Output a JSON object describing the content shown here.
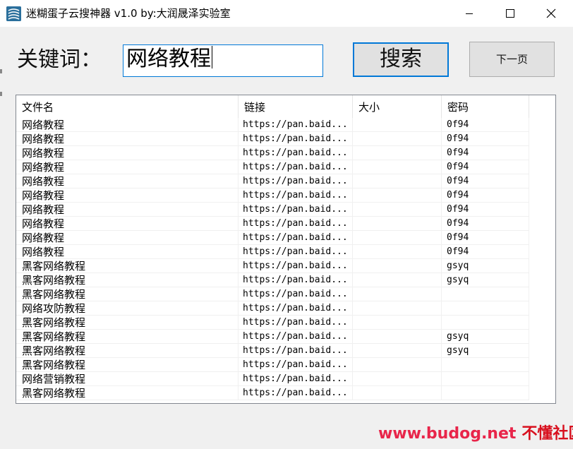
{
  "window": {
    "title": "迷糊蛋子云搜神器 v1.0  by:大润晟泽实验室",
    "icon": "app-logo-icon",
    "controls": [
      "minimize-icon",
      "maximize-icon",
      "close-icon"
    ]
  },
  "search": {
    "label": "关键词：",
    "value": "网络教程",
    "button_label": "搜索",
    "next_label": "下一页"
  },
  "table": {
    "columns": [
      "文件名",
      "链接",
      "大小",
      "密码"
    ],
    "rows": [
      [
        "网络教程",
        "https://pan.baid...",
        "",
        "0f94"
      ],
      [
        "网络教程",
        "https://pan.baid...",
        "",
        "0f94"
      ],
      [
        "网络教程",
        "https://pan.baid...",
        "",
        "0f94"
      ],
      [
        "网络教程",
        "https://pan.baid...",
        "",
        "0f94"
      ],
      [
        "网络教程",
        "https://pan.baid...",
        "",
        "0f94"
      ],
      [
        "网络教程",
        "https://pan.baid...",
        "",
        "0f94"
      ],
      [
        "网络教程",
        "https://pan.baid...",
        "",
        "0f94"
      ],
      [
        "网络教程",
        "https://pan.baid...",
        "",
        "0f94"
      ],
      [
        "网络教程",
        "https://pan.baid...",
        "",
        "0f94"
      ],
      [
        "网络教程",
        "https://pan.baid...",
        "",
        "0f94"
      ],
      [
        "黑客网络教程",
        "https://pan.baid...",
        "",
        "gsyq"
      ],
      [
        "黑客网络教程",
        "https://pan.baid...",
        "",
        "gsyq"
      ],
      [
        "黑客网络教程",
        "https://pan.baid...",
        "",
        ""
      ],
      [
        "网络攻防教程",
        "https://pan.baid...",
        "",
        ""
      ],
      [
        "黑客网络教程",
        "https://pan.baid...",
        "",
        ""
      ],
      [
        "黑客网络教程",
        "https://pan.baid...",
        "",
        "gsyq"
      ],
      [
        "黑客网络教程",
        "https://pan.baid...",
        "",
        "gsyq"
      ],
      [
        "黑客网络教程",
        "https://pan.baid...",
        "",
        ""
      ],
      [
        "网络营销教程",
        "https://pan.baid...",
        "",
        ""
      ],
      [
        "黑客网络教程",
        "https://pan.baid...",
        "",
        ""
      ]
    ]
  },
  "watermark": {
    "site": "www.budog.net",
    "name": "不懂社区"
  },
  "colors": {
    "accent": "#0078d7",
    "watermark": "#e8254a"
  }
}
